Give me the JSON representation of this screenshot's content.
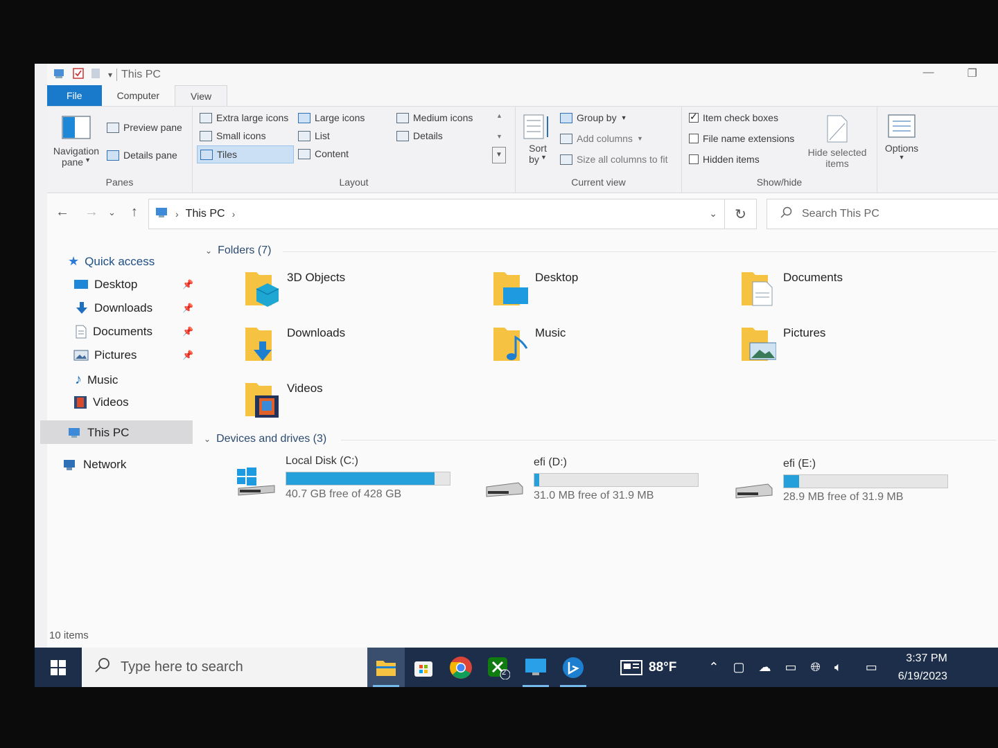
{
  "window": {
    "title": "This PC",
    "controls": {
      "minimize": "—",
      "restore": "❐"
    }
  },
  "ribbon": {
    "tabs": [
      "File",
      "Computer",
      "View"
    ],
    "panes": {
      "navigation_pane": "Navigation",
      "navigation_pane_2": "pane",
      "preview_pane": "Preview pane",
      "details_pane": "Details pane",
      "label": "Panes"
    },
    "layout": {
      "items": [
        "Extra large icons",
        "Large icons",
        "Medium icons",
        "Small icons",
        "List",
        "Details",
        "Tiles",
        "Content"
      ],
      "selected": "Tiles",
      "label": "Layout"
    },
    "current_view": {
      "sort_by": "Sort",
      "sort_by_2": "by",
      "group_by": "Group by",
      "add_columns": "Add columns",
      "size_columns": "Size all columns to fit",
      "label": "Current view"
    },
    "show_hide": {
      "item_check_boxes": "Item check boxes",
      "item_check_boxes_checked": true,
      "file_name_extensions": "File name extensions",
      "file_name_extensions_checked": false,
      "hidden_items": "Hidden items",
      "hidden_items_checked": false,
      "hide_selected": "Hide selected",
      "hide_selected_2": "items",
      "label": "Show/hide"
    },
    "options": "Options"
  },
  "address": {
    "path": "This PC",
    "search_placeholder": "Search This PC"
  },
  "nav": {
    "quick_access": "Quick access",
    "pinned": [
      "Desktop",
      "Downloads",
      "Documents",
      "Pictures"
    ],
    "unpinned": [
      "Music",
      "Videos"
    ],
    "this_pc": "This PC",
    "network": "Network"
  },
  "content": {
    "folders_header": "Folders (7)",
    "folders": [
      "3D Objects",
      "Desktop",
      "Documents",
      "Downloads",
      "Music",
      "Pictures",
      "Videos"
    ],
    "devices_header": "Devices and drives (3)",
    "drives": [
      {
        "name": "Local Disk (C:)",
        "free": "40.7 GB free of 428 GB",
        "used_fraction": 0.905
      },
      {
        "name": "efi (D:)",
        "free": "31.0 MB free of 31.9 MB",
        "used_fraction": 0.028
      },
      {
        "name": "efi (E:)",
        "free": "28.9 MB free of 31.9 MB",
        "used_fraction": 0.094
      }
    ]
  },
  "status": {
    "items": "10 items"
  },
  "taskbar": {
    "search_placeholder": "Type here to search",
    "weather": "88°F",
    "xbox_badge": "2",
    "time": "3:37 PM",
    "date": "6/19/2023"
  },
  "colors": {
    "accent": "#1979ca",
    "drive_fill": "#26a0da",
    "folder": "#f6c242",
    "taskbar": "#1c2e4a"
  }
}
